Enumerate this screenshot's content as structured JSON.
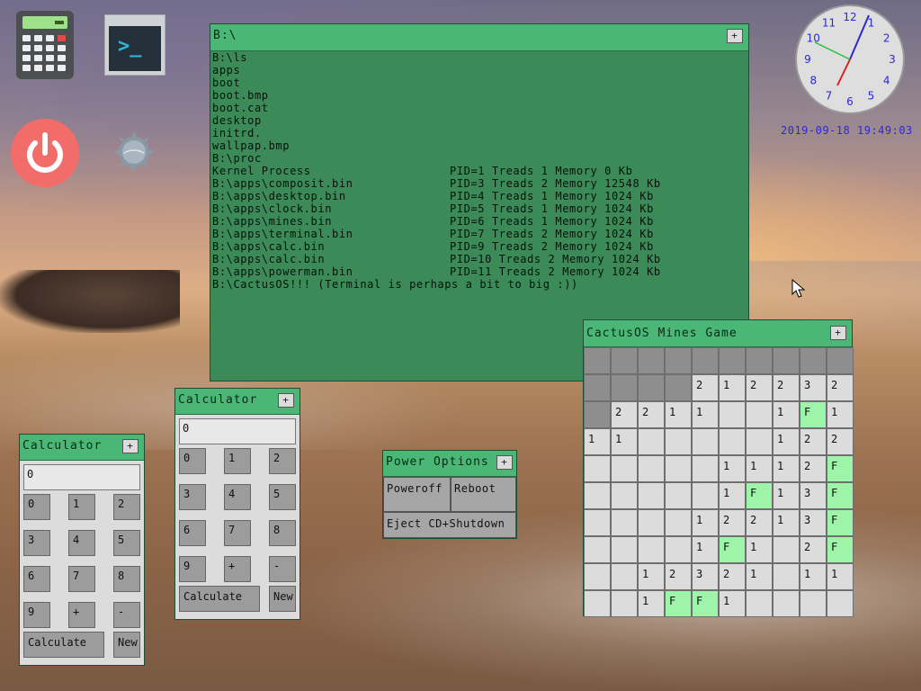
{
  "colors": {
    "window_title": "#4bb777",
    "terminal_bg": "#3d8a59",
    "flag_cell": "#9ef5a9",
    "clock_text": "#2a28d8"
  },
  "desktop": {
    "icons": [
      "calculator-app-icon",
      "terminal-app-icon",
      "power-icon",
      "settings-gear-icon"
    ],
    "clock": {
      "numerals": [
        "12",
        "1",
        "2",
        "3",
        "4",
        "5",
        "6",
        "7",
        "8",
        "9",
        "10",
        "11"
      ]
    },
    "datetime": "2019-09-18 19:49:03"
  },
  "terminal": {
    "title": "B:\\",
    "close_label": "+",
    "lines": [
      {
        "a": "B:\\ls",
        "b": ""
      },
      {
        "a": "apps",
        "b": ""
      },
      {
        "a": "boot",
        "b": ""
      },
      {
        "a": "boot.bmp",
        "b": ""
      },
      {
        "a": "boot.cat",
        "b": ""
      },
      {
        "a": "desktop",
        "b": ""
      },
      {
        "a": "initrd.",
        "b": ""
      },
      {
        "a": "wallpap.bmp",
        "b": ""
      },
      {
        "a": "B:\\proc",
        "b": ""
      },
      {
        "a": "Kernel Process",
        "b": "PID=1 Treads 1 Memory 0 Kb"
      },
      {
        "a": "B:\\apps\\composit.bin",
        "b": "PID=3 Treads 2 Memory 12548 Kb"
      },
      {
        "a": "B:\\apps\\desktop.bin",
        "b": "PID=4 Treads 1 Memory 1024 Kb"
      },
      {
        "a": "B:\\apps\\clock.bin",
        "b": "PID=5 Treads 1 Memory 1024 Kb"
      },
      {
        "a": "B:\\apps\\mines.bin",
        "b": "PID=6 Treads 1 Memory 1024 Kb"
      },
      {
        "a": "B:\\apps\\terminal.bin",
        "b": "PID=7 Treads 2 Memory 1024 Kb"
      },
      {
        "a": "B:\\apps\\calc.bin",
        "b": "PID=9 Treads 2 Memory 1024 Kb"
      },
      {
        "a": "B:\\apps\\calc.bin",
        "b": "PID=10 Treads 2 Memory 1024 Kb"
      },
      {
        "a": "B:\\apps\\powerman.bin",
        "b": "PID=11 Treads 2 Memory 1024 Kb"
      },
      {
        "a": "B:\\CactusOS!!! (Terminal is perhaps a bit to big :))",
        "b": ""
      }
    ]
  },
  "calculator_1": {
    "title": "Calculator",
    "close_label": "+",
    "display": "0",
    "keys": [
      "0",
      "1",
      "2",
      "3",
      "4",
      "5",
      "6",
      "7",
      "8",
      "9",
      "+",
      "-"
    ],
    "calculate_label": "Calculate",
    "new_label": "New"
  },
  "calculator_2": {
    "title": "Calculator",
    "close_label": "+",
    "display": "0",
    "keys": [
      "0",
      "1",
      "2",
      "3",
      "4",
      "5",
      "6",
      "7",
      "8",
      "9",
      "+",
      "-"
    ],
    "calculate_label": "Calculate",
    "new_label": "New"
  },
  "power": {
    "title": "Power Options",
    "close_label": "+",
    "poweroff_label": "Poweroff",
    "reboot_label": "Reboot",
    "eject_label": "Eject CD+Shutdown"
  },
  "mines": {
    "title": "CactusOS Mines Game",
    "close_label": "+",
    "grid": [
      [
        "H",
        "H",
        "H",
        "H",
        "H",
        "H",
        "H",
        "H",
        "H",
        "H"
      ],
      [
        "H",
        "H",
        "H",
        "H",
        "2",
        "1",
        "2",
        "2",
        "3",
        "2"
      ],
      [
        "H",
        "2",
        "2",
        "1",
        "1",
        "",
        "",
        "1",
        "F",
        "1"
      ],
      [
        "1",
        "1",
        "",
        "",
        "",
        "",
        "",
        "1",
        "2",
        "2"
      ],
      [
        "",
        "",
        "",
        "",
        "",
        "1",
        "1",
        "1",
        "2",
        "F"
      ],
      [
        "",
        "",
        "",
        "",
        "",
        "1",
        "F",
        "1",
        "3",
        "F"
      ],
      [
        "",
        "",
        "",
        "",
        "1",
        "2",
        "2",
        "1",
        "3",
        "F"
      ],
      [
        "",
        "",
        "",
        "",
        "1",
        "F",
        "1",
        "",
        "2",
        "F"
      ],
      [
        "",
        "",
        "1",
        "2",
        "3",
        "2",
        "1",
        "",
        "1",
        "1"
      ],
      [
        "",
        "",
        "1",
        "F",
        "F",
        "1",
        "",
        "",
        "",
        ""
      ]
    ]
  }
}
